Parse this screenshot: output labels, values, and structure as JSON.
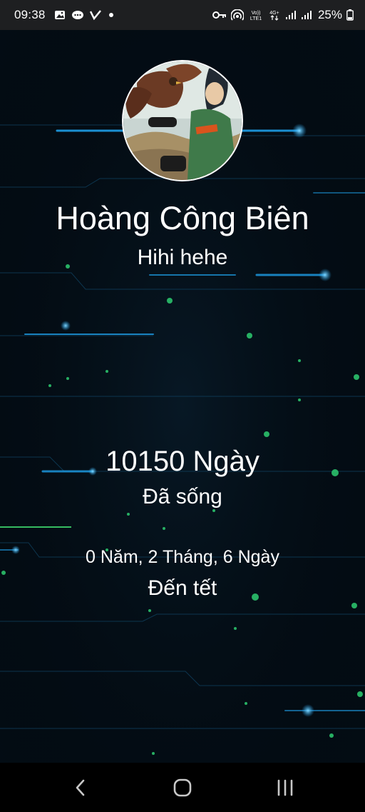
{
  "status_bar": {
    "time": "09:38",
    "battery_percent": "25%",
    "left_icons": [
      "gallery-icon",
      "messenger-icon",
      "v-app-icon",
      "dot-icon"
    ],
    "right_icons": [
      "key-icon",
      "hotspot-icon",
      "volte-icon",
      "4g-icon",
      "signal-icon",
      "signal-icon-2",
      "battery-icon"
    ],
    "volte_label": "Vo)) LTE1",
    "network_label": "4G+"
  },
  "profile": {
    "name": "Hoàng Công Biên",
    "status": "Hihi hehe"
  },
  "stats": {
    "days_lived": "10150 Ngày",
    "days_lived_label": "Đã sống",
    "tet_countdown": "0 Năm, 2 Tháng, 6 Ngày",
    "tet_label": "Đến tết"
  },
  "nav_bar": {
    "buttons": [
      "back-icon",
      "home-icon",
      "recents-icon"
    ]
  },
  "colors": {
    "background": "#030c14",
    "circuit_blue": "#1e9fe8",
    "circuit_green": "#2ecc71",
    "text": "#ffffff"
  }
}
